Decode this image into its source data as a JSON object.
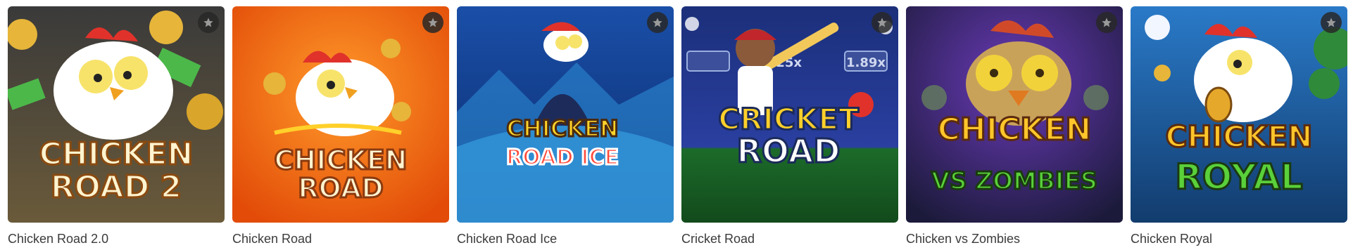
{
  "games": [
    {
      "title": "Chicken Road 2.0",
      "logo_lines": [
        "CHICKEN",
        "ROAD 2"
      ],
      "bg": "#2c2c2c",
      "bg2": "#6a5a3a",
      "icon": "star-icon"
    },
    {
      "title": "Chicken Road",
      "logo_lines": [
        "CHICKEN",
        "ROAD"
      ],
      "bg": "#f07a12",
      "bg2": "#e24b08",
      "icon": "star-icon"
    },
    {
      "title": "Chicken Road Ice",
      "logo_lines": [
        "CHICKEN",
        "ROAD ICE"
      ],
      "bg": "#1a4fa8",
      "bg2": "#0b2a6b",
      "icon": "star-icon"
    },
    {
      "title": "Cricket Road",
      "logo_lines": [
        "CRICKET",
        "ROAD"
      ],
      "bg": "#1b2f7a",
      "bg2": "#1c6b2a",
      "icon": "star-icon"
    },
    {
      "title": "Chicken vs Zombies",
      "logo_lines": [
        "CHICKEN",
        "VS ZOMBIES"
      ],
      "bg": "#4b2a8a",
      "bg2": "#1b1a3a",
      "icon": "star-icon"
    },
    {
      "title": "Chicken Royal",
      "logo_lines": [
        "CHICKEN",
        "ROYAL"
      ],
      "bg": "#1f5fa6",
      "bg2": "#123c6e",
      "icon": "star-icon"
    }
  ],
  "cricket_multipliers": [
    "7.25x",
    "1.89x"
  ]
}
